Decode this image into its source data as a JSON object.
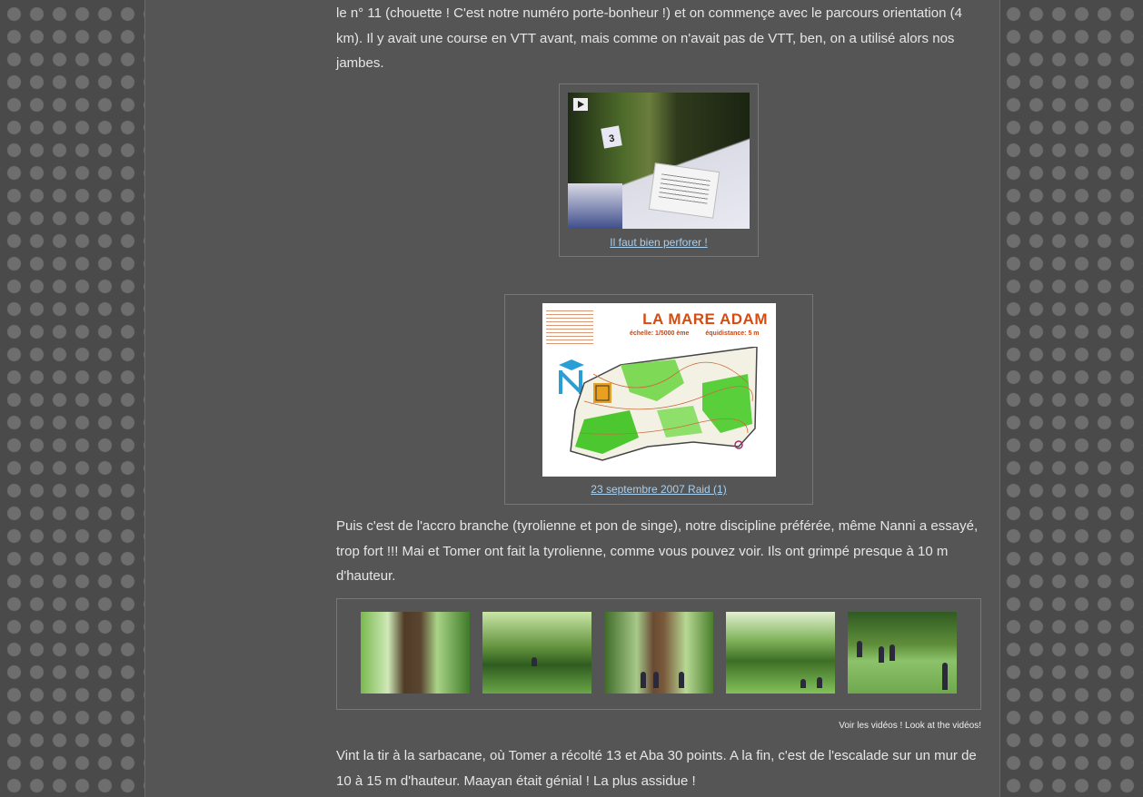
{
  "article": {
    "paragraph1": "le n° 11 (chouette ! C'est notre numéro porte-bonheur !) et on commençe avec le parcours orientation (4 km). Il y avait une course en VTT avant, mais comme on n'avait pas de VTT, ben, on a utilisé alors nos jambes.",
    "paragraph2": "Puis c'est de l'accro branche (tyrolienne et pon de singe), notre discipline préférée, même Nanni a essayé, trop fort !!! Mai et Tomer ont fait la tyrolienne, comme vous pouvez voir. Ils ont grimpé presque à 10 m d'hauteur.",
    "paragraph3": "Vint la tir à la sarbacane, où Tomer a récolté 13 et Aba 30 points. A la fin, c'est de l'escalade sur un mur de 10 à 15 m d'hauteur. Maayan était génial ! La plus assidue !"
  },
  "video1": {
    "caption": "Il faut bien perforer !",
    "tag": "3"
  },
  "map_photo": {
    "caption": "23 septembre 2007 Raid (1)",
    "title": "LA MARE ADAM",
    "scale": "échelle: 1/5000 ème",
    "equidistance": "équidistance: 5 m"
  },
  "gallery": {
    "thumbs": [
      "photo-1",
      "photo-2",
      "photo-3",
      "photo-4",
      "photo-5"
    ]
  },
  "videos_link": "Voir les vidéos ! Look at the vidéos!",
  "colors": {
    "page_bg": "#4a4a4a",
    "column_bg": "#555555",
    "text": "#e6e6e6",
    "link": "#a8cfee",
    "map_title": "#d44c12"
  }
}
